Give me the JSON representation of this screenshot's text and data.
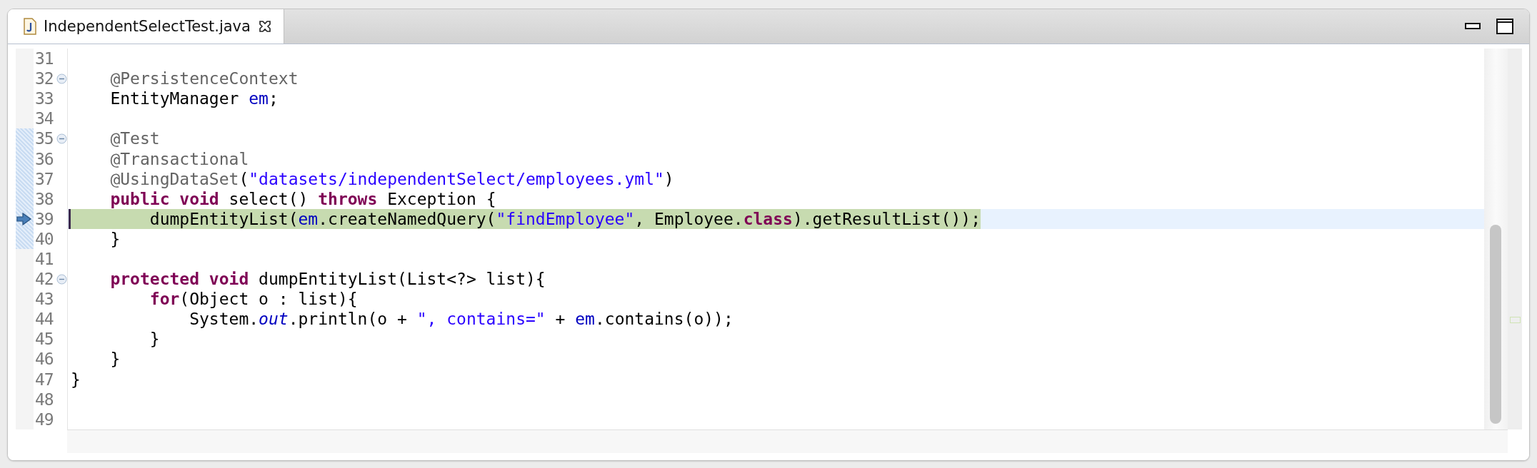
{
  "tab": {
    "title": "IndependentSelectTest.java",
    "selected": true
  },
  "lines": [
    {
      "number": "31",
      "fold": false,
      "range": false,
      "current": false
    },
    {
      "number": "32",
      "fold": true,
      "range": false,
      "current": false,
      "tokens": [
        {
          "kind": "annotation",
          "text": "    @PersistenceContext"
        }
      ]
    },
    {
      "number": "33",
      "fold": false,
      "range": false,
      "current": false,
      "tokens": [
        {
          "kind": "plain",
          "text": "    EntityManager "
        },
        {
          "kind": "field",
          "text": "em"
        },
        {
          "kind": "plain",
          "text": ";"
        }
      ]
    },
    {
      "number": "34",
      "fold": false,
      "range": false,
      "current": false
    },
    {
      "number": "35",
      "fold": true,
      "range": true,
      "current": false,
      "tokens": [
        {
          "kind": "annotation",
          "text": "    @Test"
        }
      ]
    },
    {
      "number": "36",
      "fold": false,
      "range": true,
      "current": false,
      "tokens": [
        {
          "kind": "annotation",
          "text": "    @Transactional"
        }
      ]
    },
    {
      "number": "37",
      "fold": false,
      "range": true,
      "current": false,
      "tokens": [
        {
          "kind": "annotation",
          "text": "    @UsingDataSet"
        },
        {
          "kind": "plain",
          "text": "("
        },
        {
          "kind": "string",
          "text": "\"datasets/independentSelect/employees.yml\""
        },
        {
          "kind": "plain",
          "text": ")"
        }
      ]
    },
    {
      "number": "38",
      "fold": false,
      "range": true,
      "current": false,
      "tokens": [
        {
          "kind": "keyword",
          "text": "    public"
        },
        {
          "kind": "keyword",
          "text": " void"
        },
        {
          "kind": "plain",
          "text": " select() "
        },
        {
          "kind": "keyword",
          "text": "throws"
        },
        {
          "kind": "plain",
          "text": " Exception {"
        }
      ]
    },
    {
      "number": "39",
      "fold": false,
      "range": true,
      "current": true,
      "tokens": [
        {
          "kind": "plain",
          "text": "        dumpEntityList("
        },
        {
          "kind": "field",
          "text": "em"
        },
        {
          "kind": "plain",
          "text": ".createNamedQuery("
        },
        {
          "kind": "string",
          "text": "\"findEmployee\""
        },
        {
          "kind": "plain",
          "text": ", Employee."
        },
        {
          "kind": "keyword",
          "text": "class"
        },
        {
          "kind": "plain",
          "text": ").getResultList());"
        }
      ]
    },
    {
      "number": "40",
      "fold": false,
      "range": true,
      "current": false,
      "tokens": [
        {
          "kind": "plain",
          "text": "    }"
        }
      ]
    },
    {
      "number": "41",
      "fold": false,
      "range": false,
      "current": false
    },
    {
      "number": "42",
      "fold": true,
      "range": false,
      "current": false,
      "tokens": [
        {
          "kind": "keyword",
          "text": "    protected"
        },
        {
          "kind": "keyword",
          "text": " void"
        },
        {
          "kind": "plain",
          "text": " dumpEntityList(List<?> list){"
        }
      ]
    },
    {
      "number": "43",
      "fold": false,
      "range": false,
      "current": false,
      "tokens": [
        {
          "kind": "keyword",
          "text": "        for"
        },
        {
          "kind": "plain",
          "text": "(Object o : list){"
        }
      ]
    },
    {
      "number": "44",
      "fold": false,
      "range": false,
      "current": false,
      "tokens": [
        {
          "kind": "plain",
          "text": "            System."
        },
        {
          "kind": "static",
          "text": "out"
        },
        {
          "kind": "plain",
          "text": ".println(o + "
        },
        {
          "kind": "string",
          "text": "\", contains=\""
        },
        {
          "kind": "plain",
          "text": " + "
        },
        {
          "kind": "field",
          "text": "em"
        },
        {
          "kind": "plain",
          "text": ".contains(o));"
        }
      ]
    },
    {
      "number": "45",
      "fold": false,
      "range": false,
      "current": false,
      "tokens": [
        {
          "kind": "plain",
          "text": "        }"
        }
      ]
    },
    {
      "number": "46",
      "fold": false,
      "range": false,
      "current": false,
      "tokens": [
        {
          "kind": "plain",
          "text": "    }"
        }
      ]
    },
    {
      "number": "47",
      "fold": false,
      "range": false,
      "current": false,
      "tokens": [
        {
          "kind": "plain",
          "text": "}"
        }
      ]
    },
    {
      "number": "48",
      "fold": false,
      "range": false,
      "current": false
    },
    {
      "number": "49",
      "fold": false,
      "range": false,
      "current": false
    }
  ]
}
